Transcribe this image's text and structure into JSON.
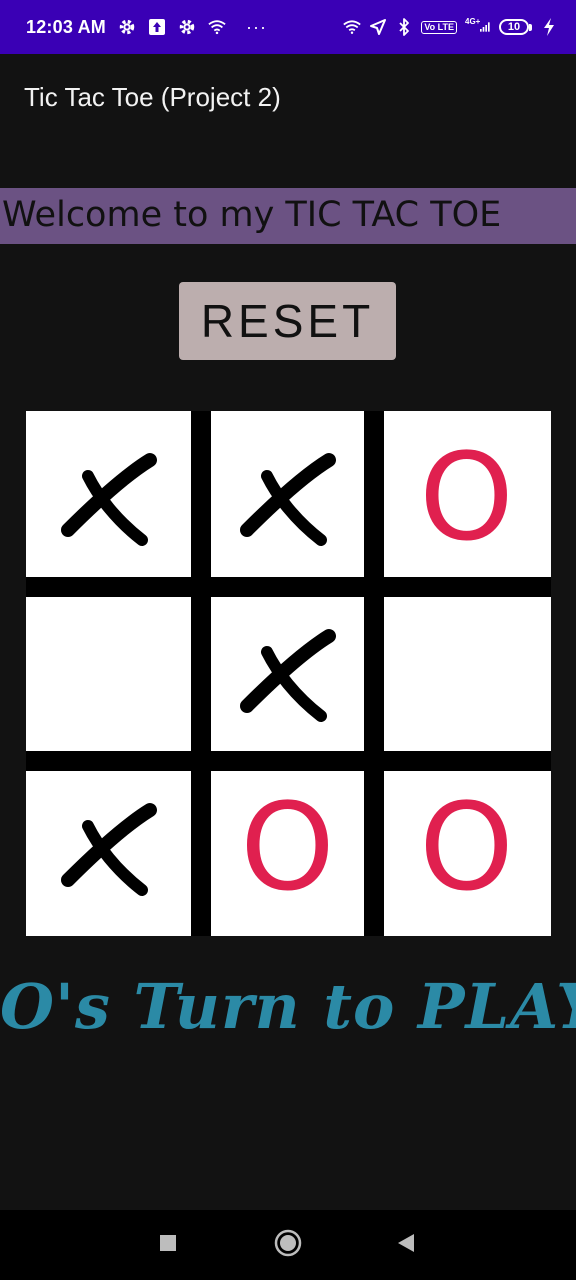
{
  "status_bar": {
    "time": "12:03 AM",
    "left_icons": [
      "gear-icon",
      "upload-icon",
      "gear-icon",
      "wifi-icon"
    ],
    "more": "···",
    "right_icons": [
      "wifi-icon",
      "location-arrow-icon",
      "bluetooth-icon",
      "volte-icon",
      "signal-icon",
      "battery-icon"
    ],
    "volte_label": "Vo LTE",
    "network_label": "4G+",
    "battery_level": "10"
  },
  "app_bar": {
    "title": "Tic Tac Toe (Project 2)"
  },
  "welcome": {
    "text": "Welcome to my TIC TAC TOE"
  },
  "reset": {
    "label": "RESET"
  },
  "board": {
    "cells": [
      "X",
      "X",
      "O",
      "",
      "X",
      "",
      "X",
      "O",
      "O"
    ]
  },
  "turn": {
    "text": "O's Turn to PLAY"
  },
  "colors": {
    "status_bar": "#3a00b5",
    "background": "#121212",
    "welcome_bg": "#6b5283",
    "reset_bg": "#bcaeae",
    "o_mark": "#e0204f",
    "turn_text": "#2b8aa6"
  },
  "nav": {
    "buttons": [
      "recents-square-icon",
      "home-circle-icon",
      "back-triangle-icon"
    ]
  }
}
